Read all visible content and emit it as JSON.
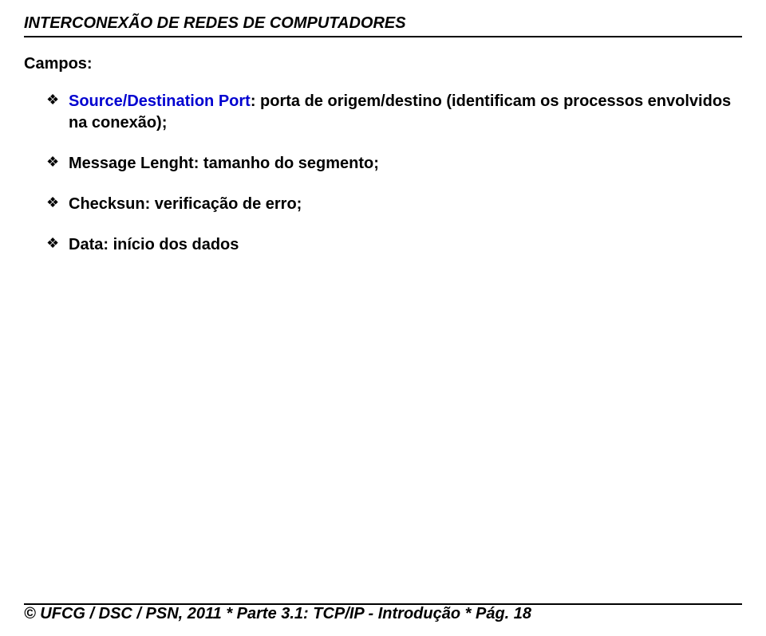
{
  "header": {
    "title": "INTERCONEXÃO DE REDES DE COMPUTADORES"
  },
  "content": {
    "subtitle": "Campos:",
    "items": [
      {
        "term": "Source/Destination Port",
        "desc": ": porta de origem/destino (identificam os processos envolvidos na conexão);",
        "highlight": true
      },
      {
        "term": "Message Lenght",
        "desc": ": tamanho do segmento;",
        "highlight": false
      },
      {
        "term": "Checksun",
        "desc": ": verificação de erro;",
        "highlight": false
      },
      {
        "term": "Data",
        "desc": ": início dos dados",
        "highlight": false
      }
    ]
  },
  "footer": {
    "text": "© UFCG / DSC / PSN, 2011 * Parte 3.1: TCP/IP - Introdução * Pág. 18"
  }
}
